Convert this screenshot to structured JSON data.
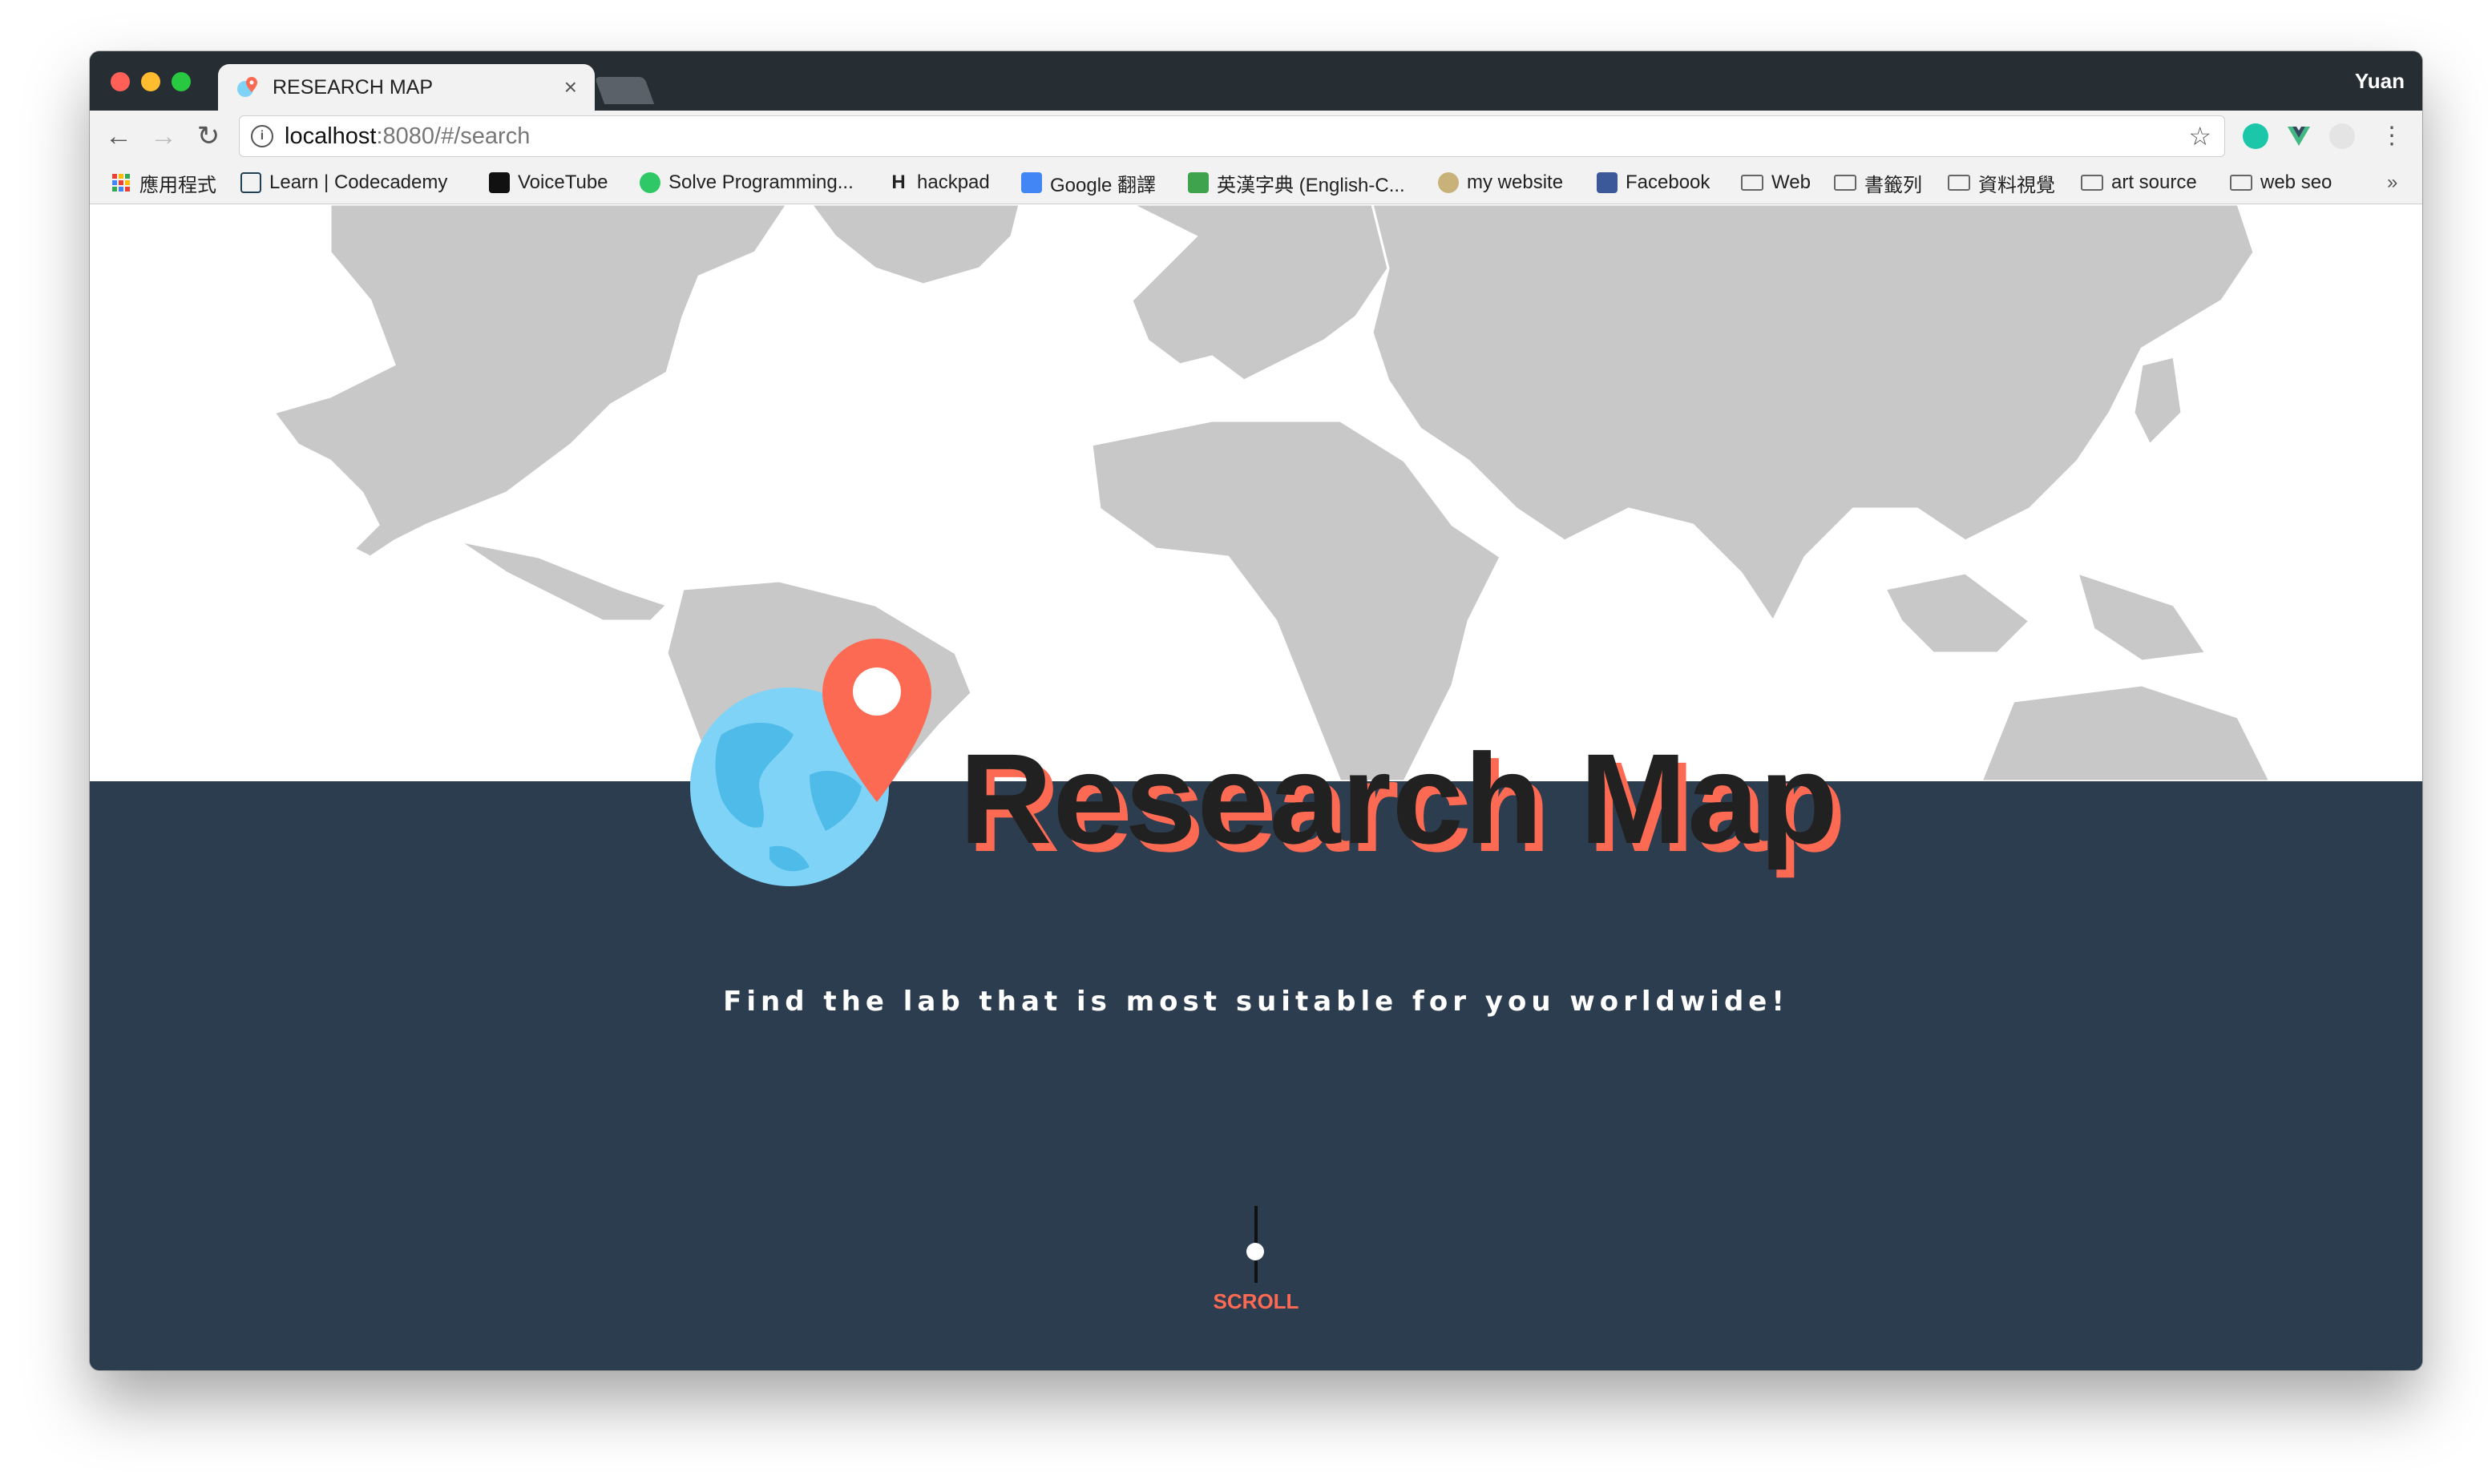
{
  "browser": {
    "tab_title": "RESEARCH MAP",
    "tab_close": "×",
    "profile_name": "Yuan",
    "url_host": "localhost",
    "url_path": ":8080/#/search",
    "bookmarks": [
      {
        "label": "應用程式",
        "icon": "apps-grid-icon"
      },
      {
        "label": "Learn | Codecademy",
        "icon": "codecademy-icon"
      },
      {
        "label": "VoiceTube",
        "icon": "voicetube-icon"
      },
      {
        "label": "Solve Programming...",
        "icon": "hackerrank-icon"
      },
      {
        "label": "hackpad",
        "icon": "hackpad-icon"
      },
      {
        "label": "Google 翻譯",
        "icon": "google-translate-icon"
      },
      {
        "label": "英漢字典 (English-C...",
        "icon": "dictionary-icon"
      },
      {
        "label": "my website",
        "icon": "website-icon"
      },
      {
        "label": "Facebook",
        "icon": "facebook-icon"
      },
      {
        "label": "Web",
        "icon": "folder-icon"
      },
      {
        "label": "書籤列",
        "icon": "folder-icon"
      },
      {
        "label": "資料視覺",
        "icon": "folder-icon"
      },
      {
        "label": "art source",
        "icon": "folder-icon"
      },
      {
        "label": "web seo",
        "icon": "folder-icon"
      }
    ],
    "more_bookmarks": "»"
  },
  "hero": {
    "title": "Research Map",
    "tagline": "Find the lab that is most suitable for you worldwide!",
    "scroll_label": "SCROLL"
  },
  "colors": {
    "accent": "#fd6a53",
    "dark_bg": "#2d3d50",
    "globe_blue": "#7fd3f7",
    "land_gray": "#c8c8c8"
  }
}
